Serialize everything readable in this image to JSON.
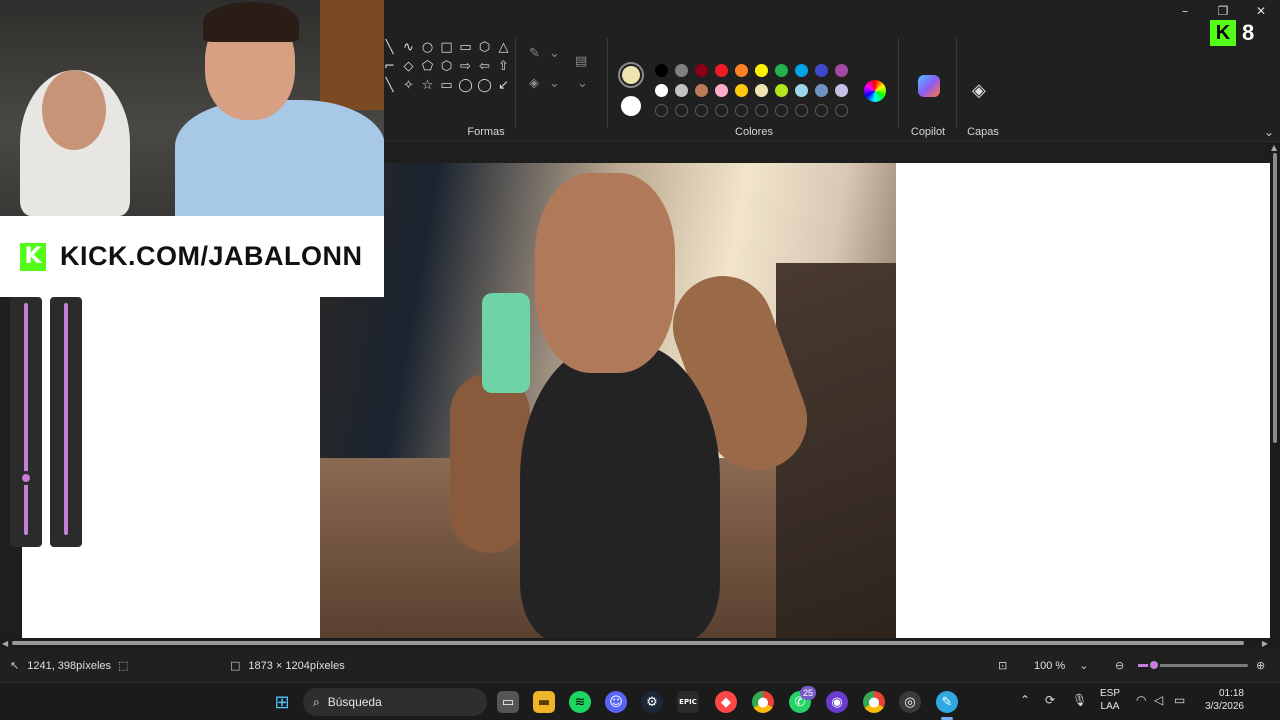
{
  "window": {
    "min": "–",
    "restore": "❐",
    "close": "✕"
  },
  "ribbon": {
    "groups": {
      "shapes": "Formas",
      "colors": "Colores",
      "copilot": "Copilot",
      "layers": "Capas"
    },
    "shapes": [
      "╲",
      "∿",
      "○",
      "□",
      "▭",
      "⬡",
      "△",
      "⌐",
      "◇",
      "⬠",
      "⬡",
      "⇨",
      "⇦",
      "⇧",
      "╲",
      "✧",
      "☆",
      "▭",
      "◯",
      "◯",
      "↙"
    ],
    "selected_color_1": "#efe4b0",
    "selected_color_2": "#ffffff",
    "palette": [
      "#000000",
      "#7f7f7f",
      "#880015",
      "#ed1c24",
      "#ff7f27",
      "#fff200",
      "#22b14c",
      "#00a2e8",
      "#3f48cc",
      "#a349a4",
      "#ffffff",
      "#c3c3c3",
      "#b97a57",
      "#ffaec9",
      "#ffc90e",
      "#efe4b0",
      "#b5e61d",
      "#99d9ea",
      "#7092be",
      "#c8bfe7",
      "",
      "",
      "",
      "",
      "",
      "",
      "",
      "",
      "",
      ""
    ],
    "expand_icon": "⌄"
  },
  "kick": {
    "badge": "K",
    "count": "8",
    "banner_logo": "K",
    "banner_text": "KICK.COM/JABALONN"
  },
  "statusbar": {
    "cursor_pos": "1241, 398píxeles",
    "canvas_size": "1873 × 1204píxeles",
    "zoom": "100 %"
  },
  "taskbar": {
    "search_placeholder": "Búsqueda",
    "whatsapp_badge": "25",
    "language": "ESP",
    "layout": "LAA",
    "time": "01:18",
    "date": "3/3/2026",
    "epic_label": "EPIC"
  }
}
